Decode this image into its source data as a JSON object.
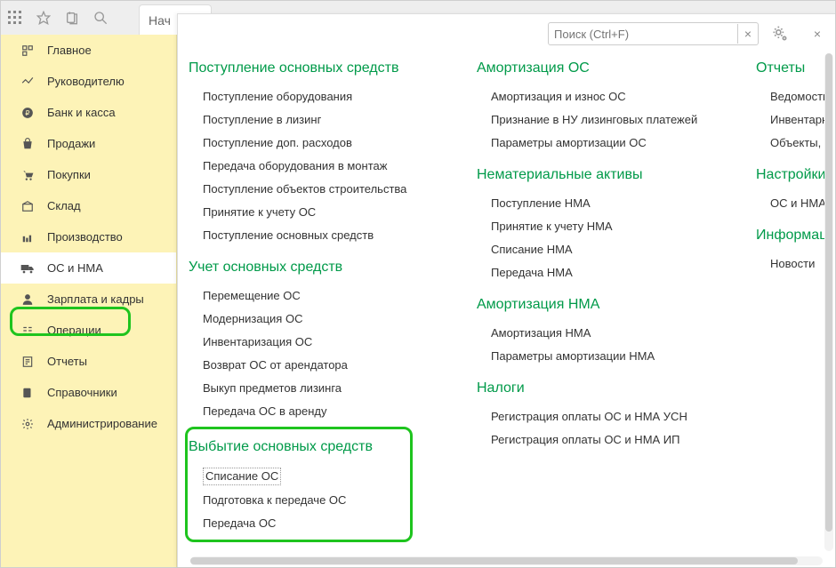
{
  "top": {
    "tab_label": "Нач"
  },
  "search": {
    "placeholder": "Поиск (Ctrl+F)",
    "clear": "×",
    "close": "×"
  },
  "sidebar": {
    "items": [
      {
        "label": "Главное"
      },
      {
        "label": "Руководителю"
      },
      {
        "label": "Банк и касса"
      },
      {
        "label": "Продажи"
      },
      {
        "label": "Покупки"
      },
      {
        "label": "Склад"
      },
      {
        "label": "Производство"
      },
      {
        "label": "ОС и НМА"
      },
      {
        "label": "Зарплата и кадры"
      },
      {
        "label": "Операции"
      },
      {
        "label": "Отчеты"
      },
      {
        "label": "Справочники"
      },
      {
        "label": "Администрирование"
      }
    ]
  },
  "col1": {
    "g1": {
      "title": "Поступление основных средств",
      "items": [
        "Поступление оборудования",
        "Поступление в лизинг",
        "Поступление доп. расходов",
        "Передача оборудования в монтаж",
        "Поступление объектов строительства",
        "Принятие к учету ОС",
        "Поступление основных средств"
      ]
    },
    "g2": {
      "title": "Учет основных средств",
      "items": [
        "Перемещение ОС",
        "Модернизация ОС",
        "Инвентаризация ОС",
        "Возврат ОС от арендатора",
        "Выкуп предметов лизинга",
        "Передача ОС в аренду"
      ]
    },
    "g3": {
      "title": "Выбытие основных средств",
      "items": [
        "Списание ОС",
        "Подготовка к передаче ОС",
        "Передача ОС"
      ]
    }
  },
  "col2": {
    "g1": {
      "title": "Амортизация ОС",
      "items": [
        "Амортизация и износ ОС",
        "Признание в НУ лизинговых платежей",
        "Параметры амортизации ОС"
      ]
    },
    "g2": {
      "title": "Нематериальные активы",
      "items": [
        "Поступление НМА",
        "Принятие к учету НМА",
        "Списание НМА",
        "Передача НМА"
      ]
    },
    "g3": {
      "title": "Амортизация НМА",
      "items": [
        "Амортизация НМА",
        "Параметры амортизации НМА"
      ]
    },
    "g4": {
      "title": "Налоги",
      "items": [
        "Регистрация оплаты ОС и НМА УСН",
        "Регистрация оплаты ОС и НМА ИП"
      ]
    }
  },
  "col3": {
    "g1": {
      "title": "Отчеты",
      "items": [
        "Ведомость ам",
        "Инвентарная к",
        "Объекты, пере"
      ]
    },
    "g2": {
      "title": "Настройки",
      "items": [
        "ОС и НМА"
      ]
    },
    "g3": {
      "title": "Информация",
      "items": [
        "Новости"
      ]
    }
  }
}
